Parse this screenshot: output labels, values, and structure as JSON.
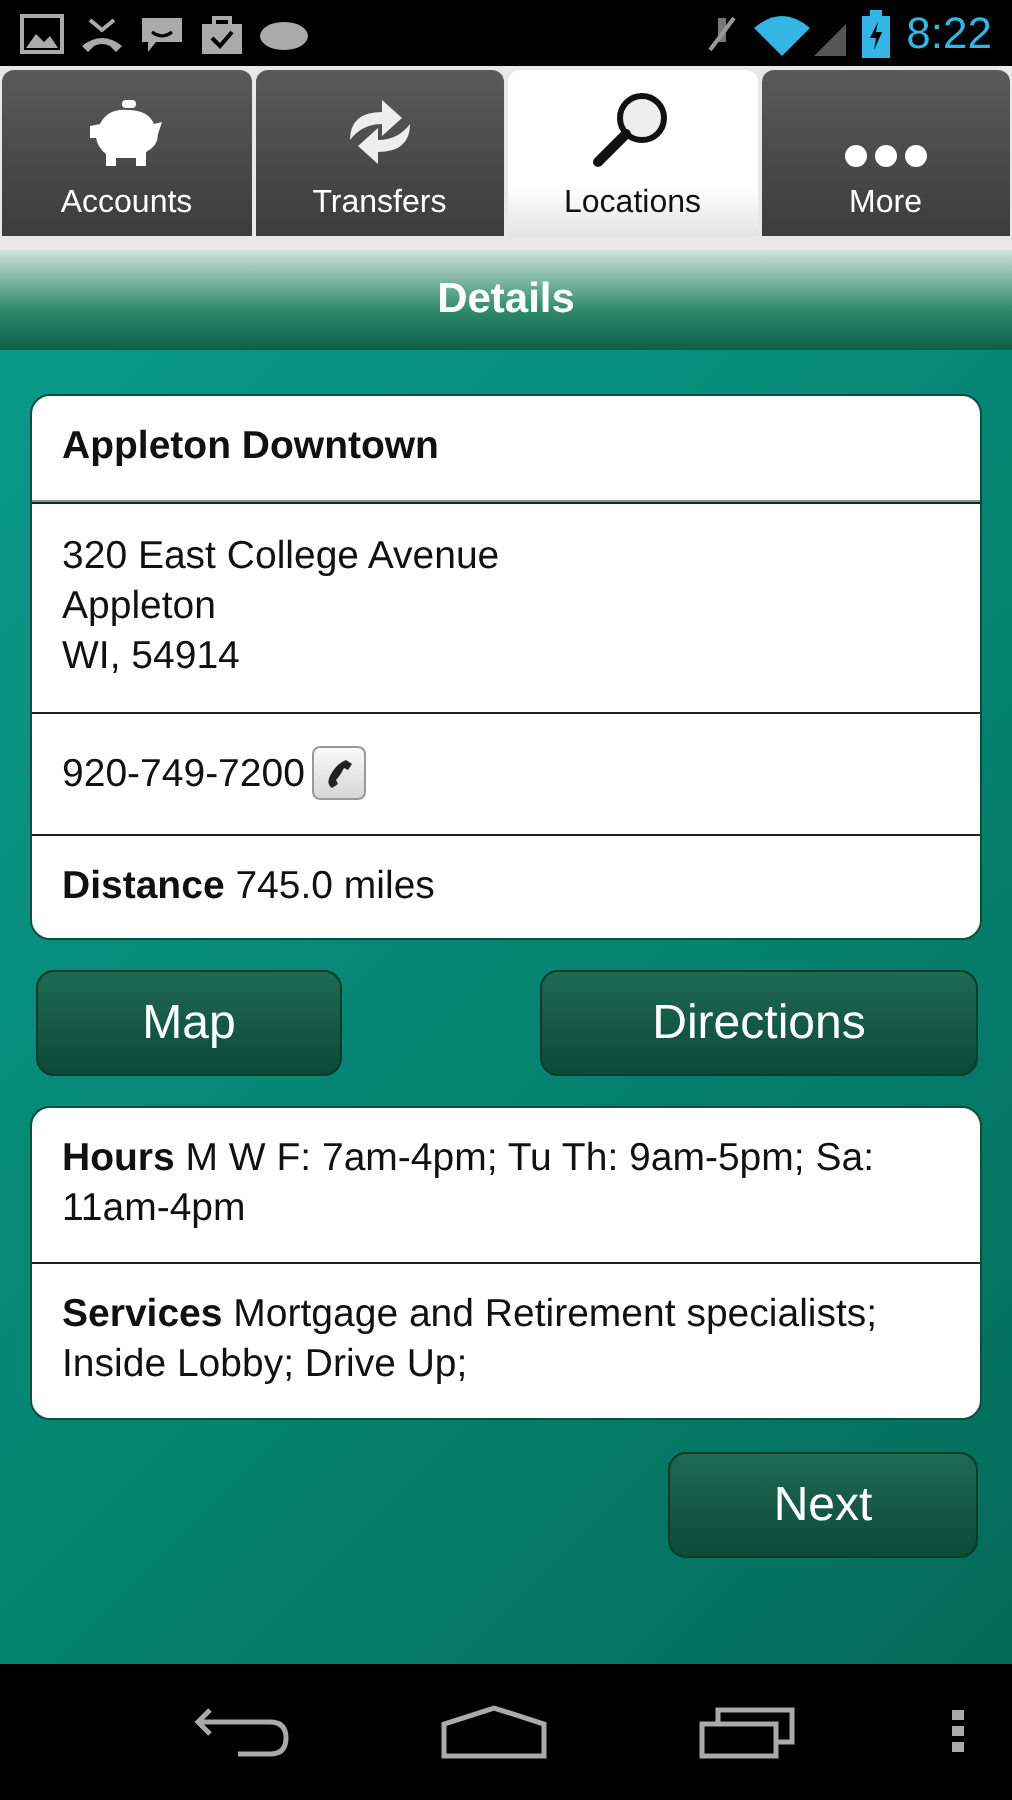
{
  "status_bar": {
    "time": "8:22"
  },
  "tabs": [
    {
      "label": "Accounts",
      "kind": "piggy",
      "selected": false
    },
    {
      "label": "Transfers",
      "kind": "transfer",
      "selected": false
    },
    {
      "label": "Locations",
      "kind": "search",
      "selected": true
    },
    {
      "label": "More",
      "kind": "more",
      "selected": false
    }
  ],
  "header": {
    "title": "Details"
  },
  "location_card": [
    {
      "kind": "title",
      "text": "Appleton Downtown"
    },
    {
      "kind": "address",
      "lines": [
        "320 East College Avenue",
        "Appleton",
        "WI, 54914"
      ]
    },
    {
      "kind": "phone",
      "text": "920-749-7200"
    },
    {
      "kind": "info",
      "text": "**Distance** 745.0 miles"
    }
  ],
  "actions": [
    "Map",
    "Directions"
  ],
  "info_card": [
    {
      "text": "**Hours**  M W F: 7am-4pm; Tu Th: 9am-5pm; Sa: 11am-4pm"
    },
    {
      "text": "**Services**  Mortgage and Retirement specialists; Inside Lobby; Drive Up;"
    }
  ],
  "next_button": "Next"
}
